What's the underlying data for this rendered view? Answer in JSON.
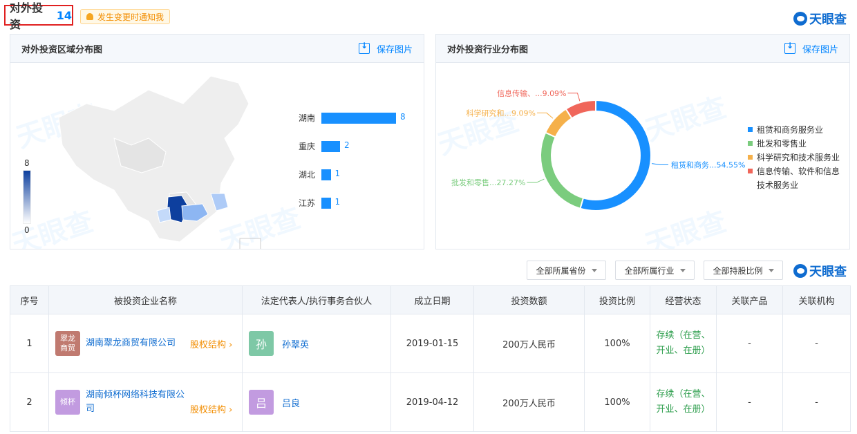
{
  "header": {
    "title": "对外投资",
    "count": "14",
    "notify_label": "发生变更时通知我",
    "logo_text": "天眼查"
  },
  "watermark": "天眼查",
  "region_panel": {
    "title": "对外投资区域分布图",
    "save_label": "保存图片",
    "map_scale_max": "8",
    "map_scale_min": "0"
  },
  "industry_panel": {
    "title": "对外投资行业分布图",
    "save_label": "保存图片"
  },
  "chart_data": [
    {
      "type": "bar",
      "orientation": "horizontal",
      "categories": [
        "湖南",
        "重庆",
        "湖北",
        "江苏"
      ],
      "values": [
        8,
        2,
        1,
        1
      ],
      "xlim": [
        0,
        8
      ]
    },
    {
      "type": "pie",
      "donut": true,
      "labels": [
        "租赁和商务服务业",
        "批发和零售业",
        "科学研究和技术服务业",
        "信息传输、软件和信息技术服务业"
      ],
      "values": [
        54.55,
        27.27,
        9.09,
        9.09
      ],
      "colors": [
        "#1890ff",
        "#7bcc7e",
        "#f5b04a",
        "#f0665a"
      ],
      "slice_labels": [
        "租赁和商务...54.55%",
        "批发和零售...27.27%",
        "科学研究和...9.09%",
        "信息传输、...9.09%"
      ],
      "legend": [
        "租赁和商务服务业",
        "批发和零售业",
        "科学研究和技术服务业",
        "信息传输、软件和信息技术服务业"
      ],
      "legend_position": "right"
    }
  ],
  "filters": [
    "全部所属省份",
    "全部所属行业",
    "全部持股比例"
  ],
  "table": {
    "columns": [
      "序号",
      "被投资企业名称",
      "法定代表人/执行事务合伙人",
      "成立日期",
      "投资数额",
      "投资比例",
      "经营状态",
      "关联产品",
      "关联机构"
    ],
    "rows": [
      {
        "no": "1",
        "logo_text": "翠龙商贸",
        "logo_color": "#c07a70",
        "company": "湖南翠龙商贸有限公司",
        "equity": "股权结构",
        "avatar_char": "孙",
        "avatar_color": "#7ec8a6",
        "person": "孙翠英",
        "date": "2019-01-15",
        "amount": "200万人民币",
        "ratio": "100%",
        "status": "存续（在营、开业、在册）",
        "product": "-",
        "org": "-"
      },
      {
        "no": "2",
        "logo_text": "倾杯",
        "logo_color": "#c29be0",
        "company": "湖南倾杯网络科技有限公司",
        "equity": "股权结构",
        "avatar_char": "吕",
        "avatar_color": "#c29be0",
        "person": "吕良",
        "date": "2019-04-12",
        "amount": "200万人民币",
        "ratio": "100%",
        "status": "存续（在营、开业、在册）",
        "product": "-",
        "org": "-"
      }
    ]
  }
}
